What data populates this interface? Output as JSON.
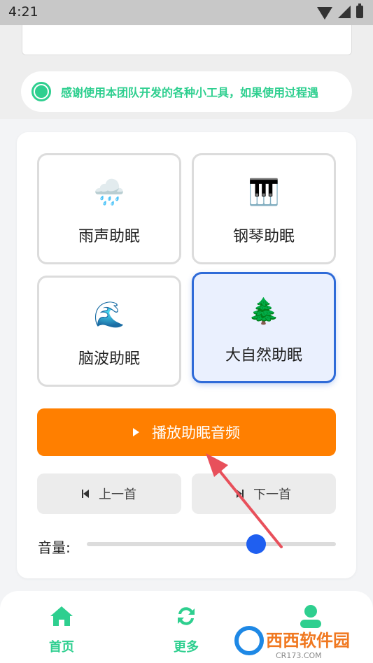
{
  "status_bar": {
    "time": "4:21"
  },
  "notice": {
    "text": "感谢使用本团队开发的各种小工具，如果使用过程遇"
  },
  "sounds": [
    {
      "emoji": "🌧️",
      "label": "雨声助眠",
      "selected": false
    },
    {
      "emoji": "🎹",
      "label": "钢琴助眠",
      "selected": false
    },
    {
      "emoji": "🌊",
      "label": "脑波助眠",
      "selected": false
    },
    {
      "emoji": "🌲",
      "label": "大自然助眠",
      "selected": true
    }
  ],
  "controls": {
    "play_label": "播放助眠音频",
    "prev_label": "上一首",
    "next_label": "下一首",
    "volume_label": "音量:",
    "volume_value": 0.68
  },
  "tabs": [
    {
      "label": "首页",
      "icon": "home-icon"
    },
    {
      "label": "更多",
      "icon": "refresh-icon"
    },
    {
      "label": "",
      "icon": "user-icon"
    }
  ],
  "watermark": {
    "text": "西西软件园",
    "subtext": "CR173.COM"
  },
  "colors": {
    "accent_green": "#2ecf8f",
    "play_orange": "#ff7f00",
    "selected_blue": "#2f6bd8",
    "slider_blue": "#1f5ff0"
  }
}
